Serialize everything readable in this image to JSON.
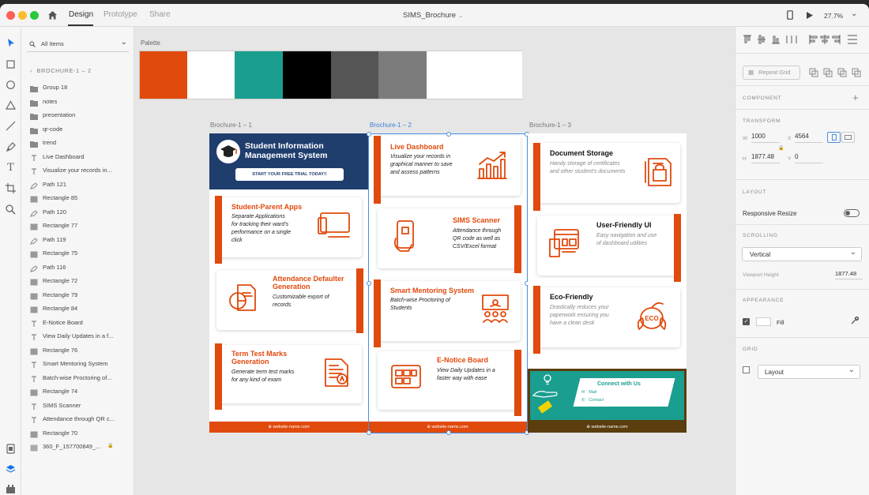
{
  "window": {
    "title": "SIMS_Brochure",
    "zoom": "27.7%",
    "tabs": [
      "Design",
      "Prototype",
      "Share"
    ]
  },
  "layers": {
    "filter": "All Items",
    "breadcrumb": "BROCHURE-1 – 2",
    "items": [
      {
        "label": "Group 18",
        "type": "folder"
      },
      {
        "label": "notes",
        "type": "folder"
      },
      {
        "label": "presentation",
        "type": "folder"
      },
      {
        "label": "qr-code",
        "type": "folder"
      },
      {
        "label": "trend",
        "type": "folder"
      },
      {
        "label": "Live Dashboard",
        "type": "text"
      },
      {
        "label": "Visualize your records in...",
        "type": "text"
      },
      {
        "label": "Path 121",
        "type": "path"
      },
      {
        "label": "Rectangle 85",
        "type": "rect"
      },
      {
        "label": "Path 120",
        "type": "path"
      },
      {
        "label": "Rectangle 77",
        "type": "rect"
      },
      {
        "label": "Path 119",
        "type": "path"
      },
      {
        "label": "Rectangle 75",
        "type": "rect"
      },
      {
        "label": "Path 116",
        "type": "path"
      },
      {
        "label": "Rectangle 72",
        "type": "rect"
      },
      {
        "label": "Rectangle 79",
        "type": "rect"
      },
      {
        "label": "Rectangle 84",
        "type": "rect"
      },
      {
        "label": "E-Notice Board",
        "type": "text"
      },
      {
        "label": "View Daily Updates in a  f...",
        "type": "text"
      },
      {
        "label": "Rectangle 76",
        "type": "rect"
      },
      {
        "label": "Smart Mentoring System",
        "type": "text"
      },
      {
        "label": "Batch-wise Proctoring of...",
        "type": "text"
      },
      {
        "label": "Rectangle 74",
        "type": "rect"
      },
      {
        "label": "SIMS Scanner",
        "type": "text"
      },
      {
        "label": "Attendance through QR c...",
        "type": "text"
      },
      {
        "label": "Rectangle 70",
        "type": "rect"
      },
      {
        "label": "360_F_157700849_...",
        "type": "image"
      }
    ]
  },
  "canvas": {
    "palette_label": "Palette",
    "palette": [
      "#e04a0d",
      "#ffffff",
      "#1a9e8f",
      "#000000",
      "#555555",
      "#7c7c7c",
      "#ffffff"
    ],
    "artboards": [
      {
        "label": "Brochure-1 – 1",
        "hero": {
          "title1": "Student Information",
          "title2": "Management System",
          "cta": "START YOUR FREE TRIAL TODAY!!"
        },
        "cards": [
          {
            "title": "Student-Parent Apps",
            "desc": [
              "Separate Applications",
              "for tracking their ward's",
              "performance on a single",
              "click"
            ]
          },
          {
            "title": "Attendance Defaulter Generation",
            "title_lines": [
              "Attendance Defaulter",
              "Generation"
            ],
            "desc": [
              "Customizable export of",
              "records"
            ]
          },
          {
            "title": "Term Test Marks Generation",
            "title_lines": [
              "Term Test Marks",
              "Generation"
            ],
            "desc": [
              "Generate term test marks",
              "for any kind of exam"
            ]
          }
        ],
        "footer": "website-name.com"
      },
      {
        "label": "Brochure-1 – 2",
        "cards": [
          {
            "title": "Live Dashboard",
            "desc": [
              "Visualize your records in",
              "graphical manner to save",
              "and assess patterns"
            ]
          },
          {
            "title": "SIMS Scanner",
            "desc": [
              "Attendance through",
              "QR code as well as",
              "CSV/Excel format"
            ]
          },
          {
            "title": "Smart Mentoring System",
            "desc": [
              "Batch-wise Proctoring of",
              "Students"
            ]
          },
          {
            "title": "E-Notice Board",
            "desc": [
              "View Daily Updates in a",
              "faster way with ease"
            ]
          }
        ],
        "footer": "website-name.com"
      },
      {
        "label": "Brochure-1 – 3",
        "cards": [
          {
            "title": "Document Storage",
            "desc": [
              "Handy storage of certificates",
              "and other student's documents"
            ]
          },
          {
            "title": "User-Friendly UI",
            "desc": [
              "Easy navigation and use",
              "of dashboard utilities"
            ]
          },
          {
            "title": "Eco-Friendly",
            "desc": [
              "Drastically reduces your",
              "paperwork ensuring you",
              "have a clean desk"
            ]
          }
        ],
        "connect": {
          "title": "Connect with Us",
          "mail": "Mail",
          "contact": "Contact",
          "eco_badge": "ECO"
        },
        "footer": "website-name.com"
      }
    ]
  },
  "inspector": {
    "repeat_grid": "Repeat Grid",
    "component": "COMPONENT",
    "transform": {
      "label": "TRANSFORM",
      "w": "1000",
      "x": "4564",
      "h": "1877.48",
      "y": "0"
    },
    "layout": {
      "label": "LAYOUT",
      "responsive_resize": "Responsive Resize",
      "responsive_on": false
    },
    "scrolling": {
      "label": "SCROLLING",
      "value": "Vertical",
      "viewport_label": "Viewport Height",
      "viewport_value": "1877.48"
    },
    "appearance": {
      "label": "APPEARANCE",
      "fill": "Fill",
      "fill_checked": true
    },
    "grid": {
      "label": "GRID",
      "value": "Layout",
      "checked": false
    }
  }
}
